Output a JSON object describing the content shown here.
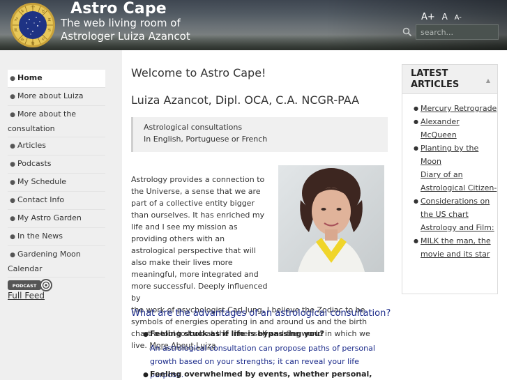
{
  "header": {
    "site_title": "Astro Cape",
    "slogan": "The web living room of Astrologer Luiza Azancot",
    "font_tools": [
      "A+",
      "A",
      "A-"
    ],
    "search_placeholder": "search..."
  },
  "nav": {
    "items": [
      {
        "label": "Home",
        "active": true
      },
      {
        "label": "More about Luiza"
      },
      {
        "label": "More about the consultation"
      },
      {
        "label": "Articles"
      },
      {
        "label": "Podcasts"
      },
      {
        "label": "My Schedule"
      },
      {
        "label": "Contact Info"
      },
      {
        "label": "My Astro Garden"
      },
      {
        "label": "In the News"
      },
      {
        "label": "Gardening Moon Calendar"
      }
    ],
    "podcast_badge": "PODCAST",
    "full_feed": "Full Feed"
  },
  "main": {
    "title": "Welcome to Astro Cape!",
    "subtitle": "Luiza Azancot, Dipl. OCA, C.A. NCGR-PAA",
    "quote_line1": "Astrological consultations",
    "quote_line2": "In English, Portuguese or French",
    "intro_text": "Astrology provides a connection to the Universe, a sense that we are part of a collective entity bigger than ourselves. It has enriched my life and I see my mission as providing others with an astrological perspective that will also make their lives more meaningful, more integrated and more successful. Deeply influenced by",
    "intro_text_2": "the work of psychologist Carl Jung, I believe the Zodiac to be symbols of energies operating in and around us and the birth chart a tool to look at the inner self and the world in which we live.",
    "more_link": "More About Luiza",
    "section_heading": "What are the advantages of an astrological consultation?",
    "advantages": [
      {
        "q": "Feeling stuck as if life is bypassing you?",
        "a": "An astrological consultation can propose paths of personal growth based on your strengths; it can reveal your life purpose."
      },
      {
        "q": "Feeling overwhelmed by events, whether personal, professional",
        "a": ""
      }
    ]
  },
  "right": {
    "heading": "LATEST ARTICLES",
    "toggle": "▲",
    "articles": [
      {
        "title": "Mercury Retrograde",
        "bullet": true
      },
      {
        "title": "Alexander McQueen",
        "bullet": true
      },
      {
        "title": "Planting by the Moon",
        "bullet": true
      },
      {
        "title": "Diary of an Astrological Citizen-Considerations on the US chart",
        "bullet": true
      },
      {
        "title": "Astrology and Film: MILK the man, the movie and its star",
        "bullet": true
      }
    ]
  }
}
